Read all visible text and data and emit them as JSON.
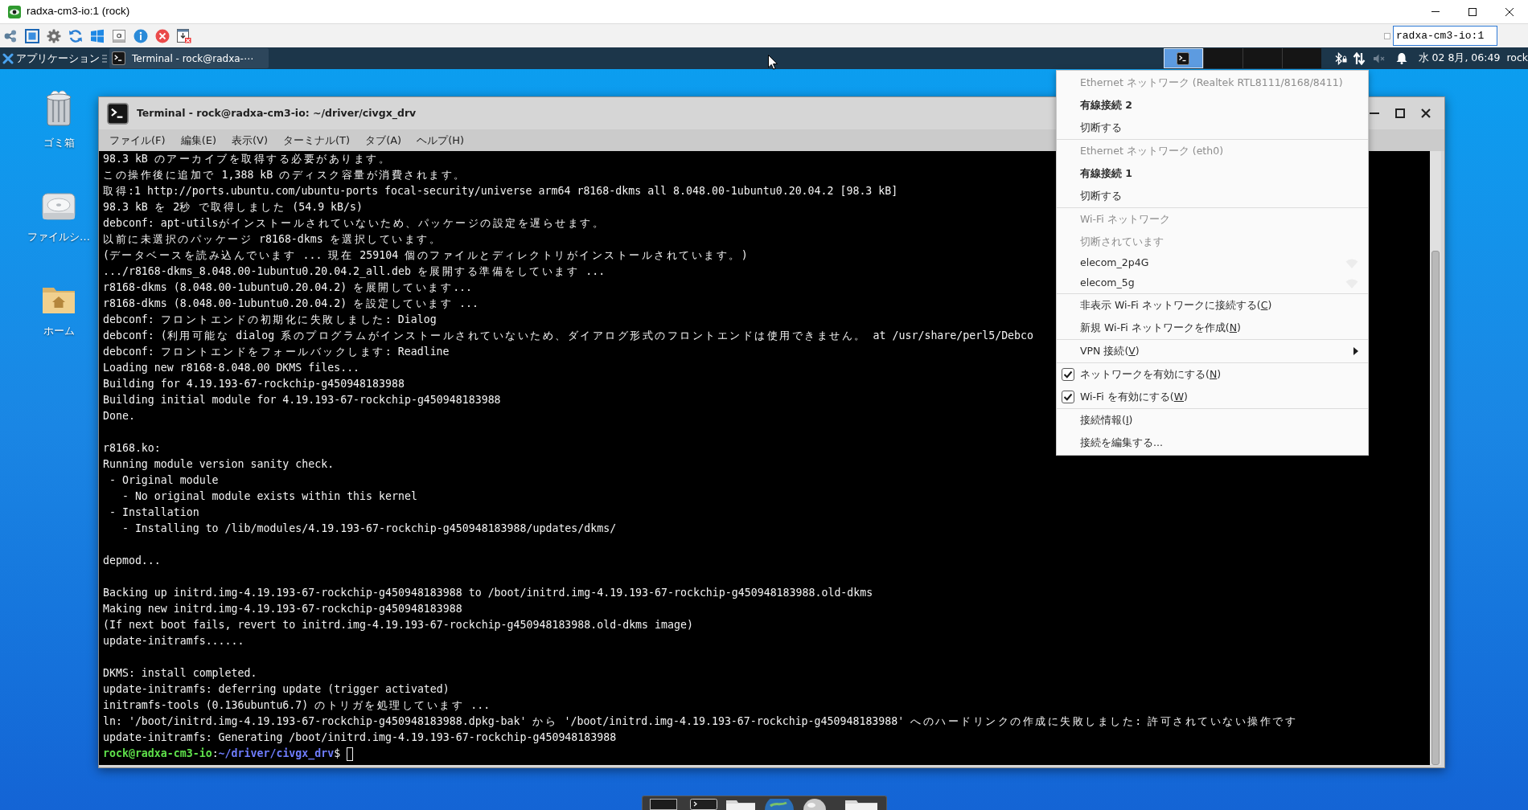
{
  "vnc_window": {
    "title": "radxa-cm3-io:1 (rock)"
  },
  "vnc_toolbar": {
    "host_field": {
      "value": "radxa-cm3-io:1"
    }
  },
  "panel": {
    "applications_menu": "アプリケーション",
    "tasks": [
      {
        "label": "Terminal - rock@radxa-⋯",
        "selected": false
      }
    ],
    "workspaces": [
      {
        "selected": true,
        "has_window": true
      },
      {
        "selected": false,
        "has_window": false
      },
      {
        "selected": false,
        "has_window": false
      },
      {
        "selected": false,
        "has_window": false
      }
    ],
    "clock": "水 02 8月, 06:49",
    "user": "rock"
  },
  "desktop_icons": [
    {
      "kind": "trash",
      "label": "ゴミ箱"
    },
    {
      "kind": "drive",
      "label": "ファイルシ…"
    },
    {
      "kind": "home",
      "label": "ホーム"
    }
  ],
  "terminal": {
    "title": "Terminal - rock@radxa-cm3-io: ~/driver/civgx_drv",
    "menu": [
      "ファイル(F)",
      "編集(E)",
      "表示(V)",
      "ターミナル(T)",
      "タブ(A)",
      "ヘルプ(H)"
    ],
    "blocks": [
      [
        "98.3 kB のアーカイブを取得する必要があります。",
        "この操作後に追加で 1,388 kB のディスク容量が消費されます。",
        "取得:1 http://ports.ubuntu.com/ubuntu-ports focal-security/universe arm64 r8168-dkms all 8.048.00-1ubuntu0.20.04.2 [98.3 kB]",
        "98.3 kB を 2秒 で取得しました (54.9 kB/s)",
        "debconf: apt-utilsがインストールされていないため、パッケージの設定を遅らせます。",
        "以前に未選択のパッケージ r8168-dkms を選択しています。",
        "(データベースを読み込んでいます ... 現在 259104 個のファイルとディレクトリがインストールされています。)",
        ".../r8168-dkms_8.048.00-1ubuntu0.20.04.2_all.deb を展開する準備をしています ...",
        "r8168-dkms (8.048.00-1ubuntu0.20.04.2) を展開しています...",
        "r8168-dkms (8.048.00-1ubuntu0.20.04.2) を設定しています ...",
        "debconf: フロントエンドの初期化に失敗しました: Dialog",
        "debconf: (利用可能な dialog 系のプログラムがインストールされていないため、ダイアログ形式のフロントエンドは使用できません。 at /usr/share/perl5/Debco",
        "debconf: フロントエンドをフォールバックします: Readline",
        "Loading new r8168-8.048.00 DKMS files...",
        "Building for 4.19.193-67-rockchip-g450948183988",
        "Building initial module for 4.19.193-67-rockchip-g450948183988",
        "Done."
      ],
      [
        "r8168.ko:",
        "Running module version sanity check.",
        " - Original module",
        "   - No original module exists within this kernel",
        " - Installation",
        "   - Installing to /lib/modules/4.19.193-67-rockchip-g450948183988/updates/dkms/"
      ],
      [
        "depmod..."
      ],
      [
        "Backing up initrd.img-4.19.193-67-rockchip-g450948183988 to /boot/initrd.img-4.19.193-67-rockchip-g450948183988.old-dkms",
        "Making new initrd.img-4.19.193-67-rockchip-g450948183988",
        "(If next boot fails, revert to initrd.img-4.19.193-67-rockchip-g450948183988.old-dkms image)",
        "update-initramfs......"
      ],
      [
        "DKMS: install completed.",
        "update-initramfs: deferring update (trigger activated)",
        "initramfs-tools (0.136ubuntu6.7) のトリガを処理しています ...",
        "ln: '/boot/initrd.img-4.19.193-67-rockchip-g450948183988.dpkg-bak' から '/boot/initrd.img-4.19.193-67-rockchip-g450948183988' へのハードリンクの作成に失敗しました: 許可されていない操作です",
        "update-initramfs: Generating /boot/initrd.img-4.19.193-67-rockchip-g450948183988"
      ]
    ],
    "prompt": {
      "user_host": "rock@radxa-cm3-io",
      "separator": ":",
      "path": "~/driver/civgx_drv",
      "symbol": "$"
    }
  },
  "network_menu": {
    "sections": [
      [
        {
          "kind": "item",
          "label": "Ethernet ネットワーク (Realtek RTL8111/8168/8411)",
          "disabled": true
        },
        {
          "kind": "connection",
          "label": "有線接続 2",
          "disabled": false
        },
        {
          "kind": "item",
          "label": "切断する",
          "disabled": false
        }
      ],
      [
        {
          "kind": "item",
          "label": "Ethernet ネットワーク (eth0)",
          "disabled": true
        },
        {
          "kind": "connection",
          "label": "有線接続 1",
          "disabled": false
        },
        {
          "kind": "item",
          "label": "切断する",
          "disabled": false
        }
      ],
      [
        {
          "kind": "item",
          "label": "Wi-Fi ネットワーク",
          "disabled": true
        },
        {
          "kind": "item",
          "label": "切断されています",
          "disabled": true
        },
        {
          "kind": "network",
          "label": "elecom_2p4G",
          "disabled": false
        },
        {
          "kind": "network",
          "label": "elecom_5g",
          "disabled": false
        }
      ],
      [
        {
          "kind": "item",
          "label": "非表示 Wi-Fi ネットワークに接続する(",
          "mnemonic": "C",
          "label_end": ")",
          "disabled": false
        },
        {
          "kind": "item",
          "label": "新規 Wi-Fi ネットワークを作成(",
          "mnemonic": "N",
          "label_end": ")",
          "disabled": false
        }
      ],
      [
        {
          "kind": "submenu",
          "label": "VPN 接続(",
          "mnemonic": "V",
          "label_end": ")",
          "disabled": false
        }
      ],
      [
        {
          "kind": "check",
          "label": "ネットワークを有効にする(",
          "mnemonic": "N",
          "label_end": ")",
          "checked": true,
          "disabled": false
        },
        {
          "kind": "check",
          "label": "Wi-Fi を有効にする(",
          "mnemonic": "W",
          "label_end": ")",
          "checked": true,
          "disabled": false
        }
      ],
      [
        {
          "kind": "item",
          "label": "接続情報(",
          "mnemonic": "I",
          "label_end": ")",
          "disabled": false
        },
        {
          "kind": "item",
          "label": "接続を編集する...",
          "disabled": false
        }
      ]
    ]
  }
}
